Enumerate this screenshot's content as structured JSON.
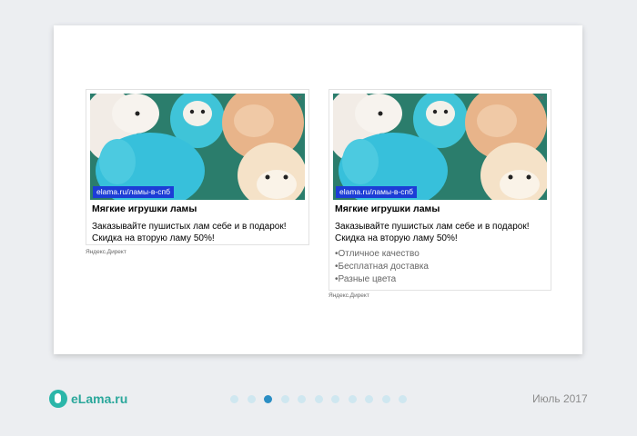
{
  "slide": {
    "ads": [
      {
        "url": "elama.ru/ламы-в-спб",
        "title": "Мягкие игрушки ламы",
        "text": "Заказывайте пушистых лам себе и в подарок! Скидка на вторую ламу 50%!",
        "features": [],
        "source": "Яндекс.Директ",
        "close_icon": "close-icon"
      },
      {
        "url": "elama.ru/ламы-в-спб",
        "title": "Мягкие игрушки ламы",
        "text": "Заказывайте пушистых лам себе и в подарок! Скидка на вторую ламу 50%!",
        "features": [
          "Отличное качество",
          "Бесплатная доставка",
          "Разные цвета"
        ],
        "source": "Яндекс.Директ",
        "close_icon": "close-icon"
      }
    ]
  },
  "footer": {
    "logo_text": "eLama.ru",
    "pagination": {
      "total": 11,
      "active": 3
    },
    "date": "Июль 2017"
  },
  "colors": {
    "brand": "#2aa79b",
    "url_badge": "#1c3dd6",
    "dot_active": "#2b8ec4",
    "dot_inactive": "#cfe7f0"
  }
}
